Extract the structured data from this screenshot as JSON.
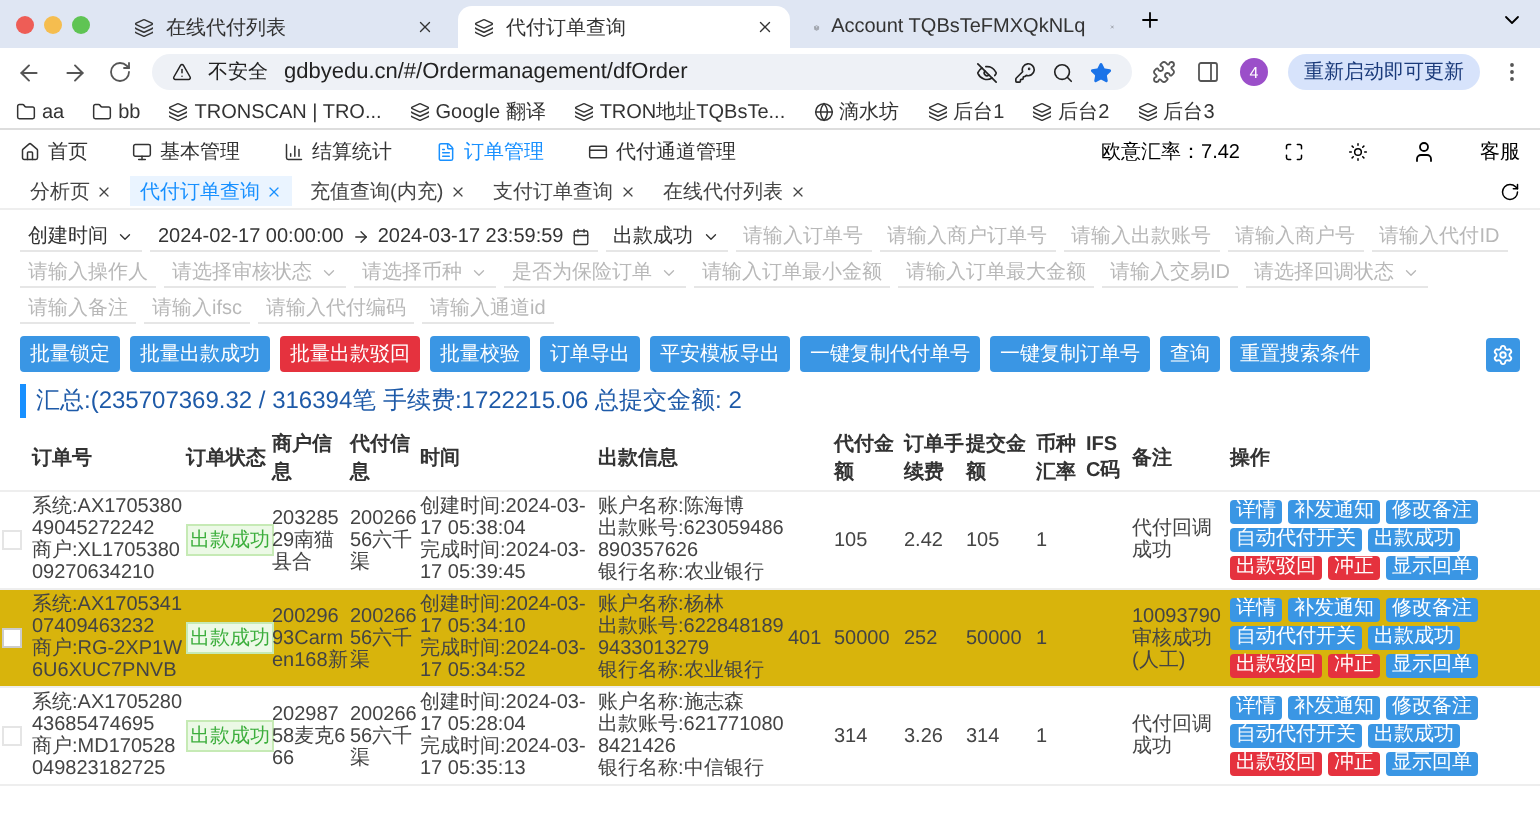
{
  "browser": {
    "tabs": [
      {
        "title": "在线代付列表",
        "selected": false
      },
      {
        "title": "代付订单查询",
        "selected": true
      },
      {
        "title": "Account TQBsTeFMXQkNLq",
        "selected": false
      }
    ],
    "security": "不安全",
    "url": "gdbyedu.cn/#/Ordermanagement/dfOrder",
    "profile": "4",
    "update_button": "重新启动即可更新",
    "bookmarks": [
      {
        "label": "aa",
        "kind": "folder"
      },
      {
        "label": "bb",
        "kind": "folder"
      },
      {
        "label": "TRONSCAN | TRO...",
        "kind": "site"
      },
      {
        "label": "Google 翻译",
        "kind": "site"
      },
      {
        "label": "TRON地址TQBsTe...",
        "kind": "site"
      },
      {
        "label": "滴水坊",
        "kind": "globe"
      },
      {
        "label": "后台1",
        "kind": "site"
      },
      {
        "label": "后台2",
        "kind": "site"
      },
      {
        "label": "后台3",
        "kind": "site"
      }
    ]
  },
  "nav": {
    "items": [
      {
        "label": "首页",
        "selected": false
      },
      {
        "label": "基本管理",
        "selected": false
      },
      {
        "label": "结算统计",
        "selected": false
      },
      {
        "label": "订单管理",
        "selected": true
      },
      {
        "label": "代付通道管理",
        "selected": false
      }
    ],
    "rate": "欧意汇率：7.42",
    "user": "客服"
  },
  "page_tabs": [
    {
      "label": "分析页",
      "selected": false
    },
    {
      "label": "代付订单查询",
      "selected": true
    },
    {
      "label": "充值查询(内充)",
      "selected": false
    },
    {
      "label": "支付订单查询",
      "selected": false
    },
    {
      "label": "在线代付列表",
      "selected": false
    }
  ],
  "filters": [
    {
      "kind": "select",
      "value": "创建时间"
    },
    {
      "kind": "daterange",
      "start": "2024-02-17 00:00:00",
      "end": "2024-03-17 23:59:59"
    },
    {
      "kind": "select",
      "value": "出款成功"
    },
    {
      "kind": "input",
      "placeholder": "请输入订单号"
    },
    {
      "kind": "input",
      "placeholder": "请输入商户订单号"
    },
    {
      "kind": "input",
      "placeholder": "请输入出款账号"
    },
    {
      "kind": "input",
      "placeholder": "请输入商户号"
    },
    {
      "kind": "input",
      "placeholder": "请输入代付ID"
    },
    {
      "kind": "input",
      "placeholder": "请输入操作人"
    },
    {
      "kind": "select",
      "placeholder": "请选择审核状态"
    },
    {
      "kind": "select",
      "placeholder": "请选择币种"
    },
    {
      "kind": "select",
      "placeholder": "是否为保险订单"
    },
    {
      "kind": "input",
      "placeholder": "请输入订单最小金额"
    },
    {
      "kind": "input",
      "placeholder": "请输入订单最大金额"
    },
    {
      "kind": "input",
      "placeholder": "请输入交易ID"
    },
    {
      "kind": "select",
      "placeholder": "请选择回调状态"
    },
    {
      "kind": "input",
      "placeholder": "请输入备注"
    },
    {
      "kind": "input",
      "placeholder": "请输入ifsc"
    },
    {
      "kind": "input",
      "placeholder": "请输入代付编码"
    },
    {
      "kind": "input",
      "placeholder": "请输入通道id"
    }
  ],
  "actions": [
    {
      "label": "批量锁定",
      "kind": "primary"
    },
    {
      "label": "批量出款成功",
      "kind": "primary"
    },
    {
      "label": "批量出款驳回",
      "kind": "danger"
    },
    {
      "label": "批量校验",
      "kind": "primary"
    },
    {
      "label": "订单导出",
      "kind": "primary"
    },
    {
      "label": "平安模板导出",
      "kind": "primary"
    },
    {
      "label": "一键复制代付单号",
      "kind": "primary"
    },
    {
      "label": "一键复制订单号",
      "kind": "primary"
    },
    {
      "label": "查询",
      "kind": "primary"
    },
    {
      "label": "重置搜索条件",
      "kind": "primary"
    }
  ],
  "summary": "汇总:(235707369.32 / 316394笔 手续费:1722215.06 总提交金额:  2",
  "table": {
    "columns": [
      {
        "label": "订单号"
      },
      {
        "label": "订单状态"
      },
      {
        "label": "商户信息"
      },
      {
        "label": "代付信息"
      },
      {
        "label": "时间"
      },
      {
        "label": "出款信息"
      },
      {},
      {
        "label": "代付金额"
      },
      {
        "label": "订单手续费"
      },
      {
        "label": "提交金额"
      },
      {
        "label": "币种汇率"
      },
      {
        "label": "IFSC码"
      },
      {
        "label": "备注"
      },
      {
        "label": "操作"
      }
    ],
    "rows": [
      {
        "selected": false,
        "order": [
          "系统:AX170538049045272242",
          "商户:XL170538009270634210"
        ],
        "status": "出款成功",
        "merchant": "20328529南猫县合",
        "payer": "20026656六千渠",
        "time": [
          "创建时间:2024-03-17 05:38:04",
          "完成时间:2024-03-17 05:39:45"
        ],
        "payout": [
          "账户名称:陈海博",
          "出款账号:623059486890357626",
          "银行名称:农业银行"
        ],
        "amount": "105",
        "fee": "2.42",
        "submitted": "105",
        "rate": "1",
        "remark": "代付回调成功",
        "actions": [
          {
            "label": "详情",
            "kind": "primary"
          },
          {
            "label": "补发通知",
            "kind": "primary"
          },
          {
            "label": "修改备注",
            "kind": "primary"
          },
          {
            "label": "自动代付开关",
            "kind": "primary"
          },
          {
            "label": "出款成功",
            "kind": "primary"
          },
          {
            "label": "出款驳回",
            "kind": "danger"
          },
          {
            "label": "冲正",
            "kind": "danger"
          },
          {
            "label": "显示回单",
            "kind": "primary"
          }
        ]
      },
      {
        "selected": true,
        "order": [
          "系统:AX170534107409463232",
          "商户:RG-2XP1W6U6XUC7PNVB"
        ],
        "status": "出款成功",
        "merchant": "20029693Carmen168新",
        "payer": "20026656六千渠",
        "time": [
          "创建时间:2024-03-17 05:34:10",
          "完成时间:2024-03-17 05:34:52"
        ],
        "payout": [
          "账户名称:杨林",
          "出款账号:6228481899433013279",
          "银行名称:农业银行"
        ],
        "column_7": "401",
        "amount": "50000",
        "fee": "252",
        "submitted": "50000",
        "rate": "1",
        "remark": "10093790审核成功(人工)",
        "actions": [
          {
            "label": "详情",
            "kind": "primary"
          },
          {
            "label": "补发通知",
            "kind": "primary"
          },
          {
            "label": "修改备注",
            "kind": "primary"
          },
          {
            "label": "自动代付开关",
            "kind": "primary"
          },
          {
            "label": "出款成功",
            "kind": "primary"
          },
          {
            "label": "出款驳回",
            "kind": "danger"
          },
          {
            "label": "冲正",
            "kind": "danger"
          },
          {
            "label": "显示回单",
            "kind": "primary"
          }
        ]
      },
      {
        "selected": false,
        "order": [
          "系统:AX170528043685474695",
          "商户:MD170528049823182725"
        ],
        "status": "出款成功",
        "merchant": "20298758麦克666",
        "payer": "20026656六千渠",
        "time": [
          "创建时间:2024-03-17 05:28:04",
          "完成时间:2024-03-17 05:35:13"
        ],
        "payout": [
          "账户名称:施志森",
          "出款账号:6217710808421426",
          "银行名称:中信银行"
        ],
        "amount": "314",
        "fee": "3.26",
        "submitted": "314",
        "rate": "1",
        "remark": "代付回调成功",
        "actions": [
          {
            "label": "详情",
            "kind": "primary"
          },
          {
            "label": "补发通知",
            "kind": "primary"
          },
          {
            "label": "修改备注",
            "kind": "primary"
          },
          {
            "label": "自动代付开关",
            "kind": "primary"
          },
          {
            "label": "出款成功",
            "kind": "primary"
          },
          {
            "label": "出款驳回",
            "kind": "danger"
          },
          {
            "label": "冲正",
            "kind": "danger"
          },
          {
            "label": "显示回单",
            "kind": "primary"
          }
        ]
      }
    ]
  }
}
